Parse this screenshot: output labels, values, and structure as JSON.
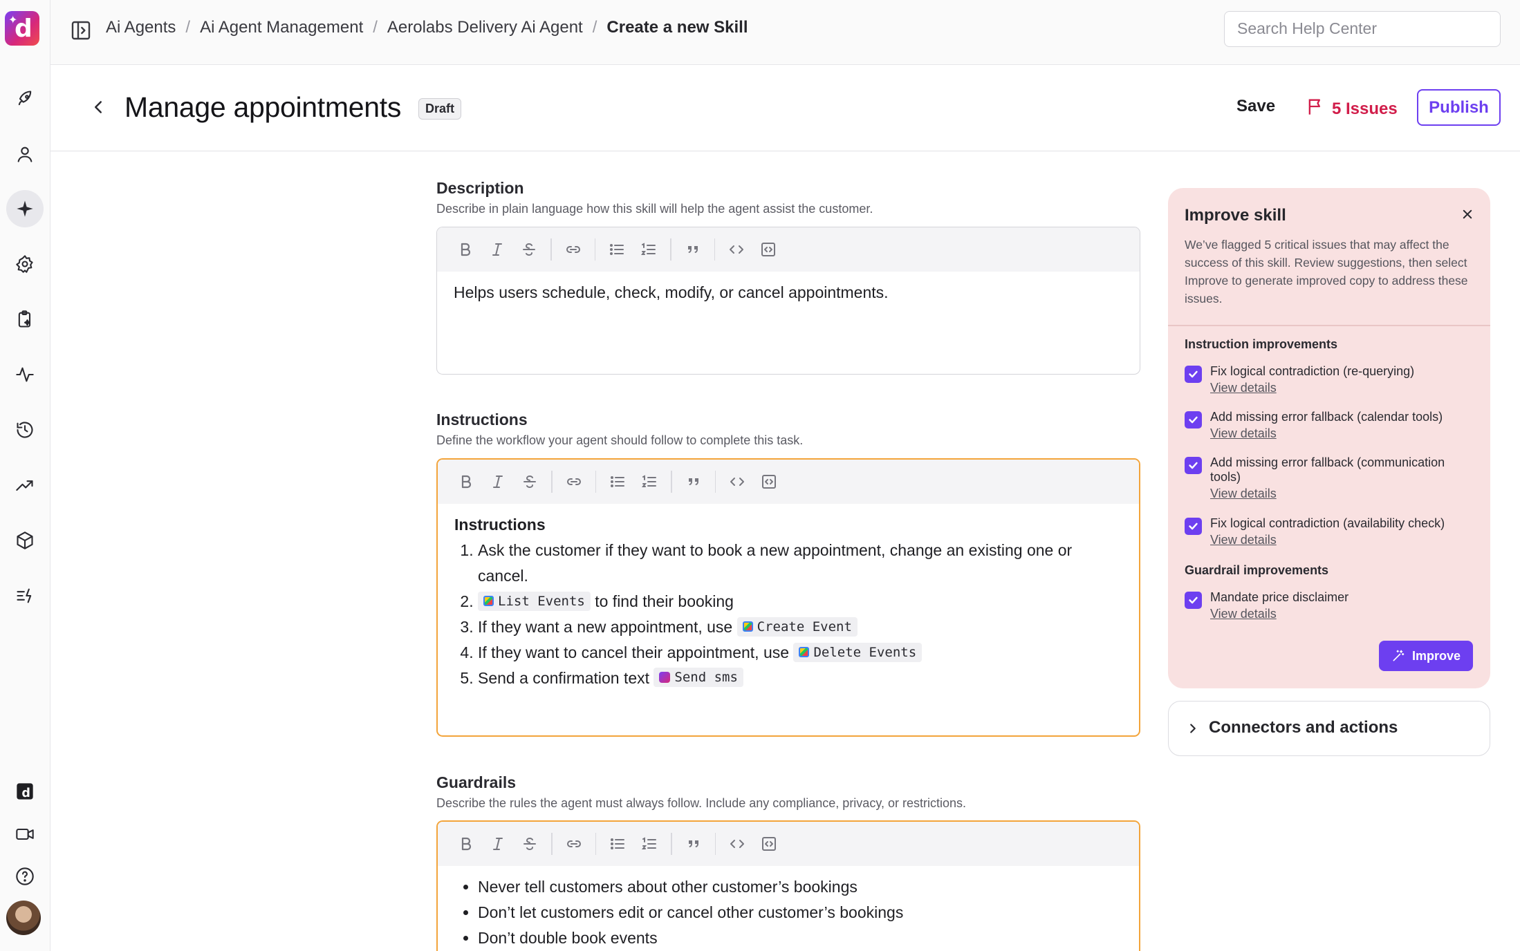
{
  "rail": {
    "logo_letter": "d",
    "items": [
      "rocket-icon",
      "user-icon",
      "sparkle-icon",
      "gear-icon",
      "clipboard-sparkle-icon",
      "activity-icon",
      "history-icon",
      "trending-icon",
      "cube-icon",
      "list-bolt-icon"
    ],
    "bottom": [
      "brand-app-icon",
      "video-icon",
      "help-icon",
      "avatar"
    ]
  },
  "breadcrumbs": {
    "items": [
      "Ai Agents",
      "Ai Agent Management",
      "Aerolabs Delivery Ai Agent"
    ],
    "current": "Create a new Skill",
    "separator": "/"
  },
  "search": {
    "placeholder": "Search Help Center"
  },
  "header": {
    "title": "Manage appointments",
    "status_badge": "Draft",
    "save_label": "Save",
    "issues_label": "5 Issues",
    "publish_label": "Publish"
  },
  "description": {
    "label": "Description",
    "help": "Describe in plain language how this skill will help the agent assist the customer.",
    "value": "Helps users schedule, check, modify, or cancel appointments."
  },
  "instructions": {
    "label": "Instructions",
    "help": "Define the workflow your agent should follow to complete this task.",
    "heading": "Instructions",
    "steps": [
      {
        "pre": "Ask the customer if they want to book a new appointment, change an existing one or cancel.",
        "chip": "",
        "post": ""
      },
      {
        "pre": "",
        "chip": "List Events",
        "post": " to find their booking"
      },
      {
        "pre": "If they want a new appointment, use ",
        "chip": "Create Event",
        "post": ""
      },
      {
        "pre": "If they want to cancel their appointment, use ",
        "chip": "Delete Events",
        "post": ""
      },
      {
        "pre": "Send a confirmation text ",
        "chip": "Send sms",
        "post": ""
      }
    ]
  },
  "guardrails": {
    "label": "Guardrails",
    "help": "Describe the rules the agent must always follow. Include any compliance, privacy, or restrictions.",
    "items": [
      "Never tell customers about other customer’s bookings",
      "Don’t let customers edit or cancel other customer’s bookings",
      "Don’t double book events"
    ]
  },
  "improve_panel": {
    "title": "Improve skill",
    "description": "We’ve flagged 5 critical issues that may affect the success of this skill. Review suggestions, then select Improve to generate improved copy to address these issues.",
    "instruction_group": "Instruction improvements",
    "instruction_items": [
      {
        "label": "Fix logical contradiction (re-querying)",
        "link": "View details",
        "checked": true
      },
      {
        "label": "Add missing error fallback (calendar tools)",
        "link": "View details",
        "checked": true
      },
      {
        "label": "Add missing error fallback (communication tools)",
        "link": "View details",
        "checked": true
      },
      {
        "label": "Fix logical contradiction (availability check)",
        "link": "View details",
        "checked": true
      }
    ],
    "guardrail_group": "Guardrail improvements",
    "guardrail_items": [
      {
        "label": "Mandate price disclaimer",
        "link": "View details",
        "checked": true
      }
    ],
    "improve_label": "Improve"
  },
  "connectors": {
    "label": "Connectors and actions"
  },
  "colors": {
    "accent": "#6d3ff0",
    "issues": "#d11d4a",
    "warning_border": "#f3a43a",
    "panel_bg": "#f9e1e1"
  }
}
